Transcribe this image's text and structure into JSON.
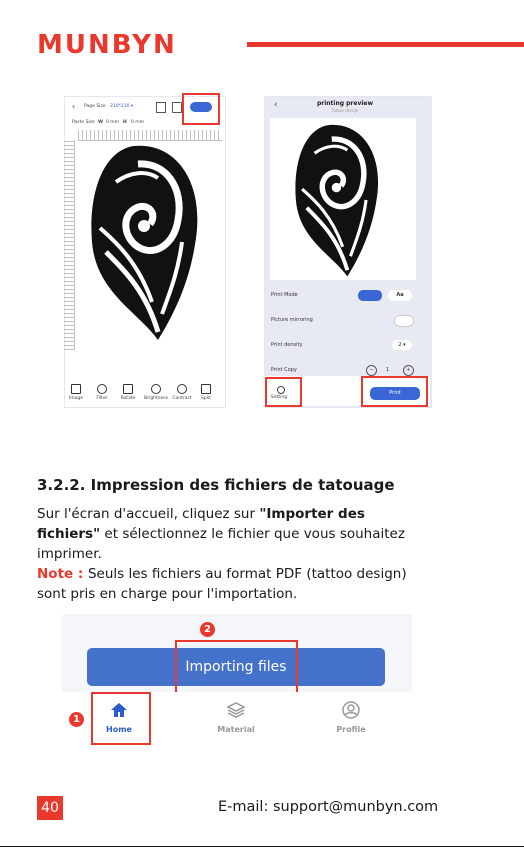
{
  "brand": {
    "logo": "MUNBYN",
    "accent": "#e8392c"
  },
  "screens": {
    "left": {
      "title_label": "Page Size",
      "title_value": "210*210 ▾",
      "paste_size_label": "Paste Size",
      "w_label": "W",
      "w_value": "0 mm",
      "h_label": "H",
      "h_value": "0 mm",
      "toolbar": [
        "Image",
        "Filter",
        "Rotate",
        "Brightness",
        "Contrast",
        "Split"
      ]
    },
    "right": {
      "title": "printing preview",
      "subtitle": "Tattoo design",
      "print_mode_label": "Print Mode",
      "print_mode_alt": "Aa",
      "mirroring_label": "Picture mirroring",
      "density_label": "Print density",
      "density_value": "2 ▾",
      "copy_label": "Print Copy",
      "copy_value": "1",
      "minus": "−",
      "plus": "+",
      "setting_label": "Setting",
      "print_label": "Print"
    }
  },
  "section": {
    "heading": "3.2.2.  Impression des fichiers de tatouage",
    "p1_a": "Sur l'écran d'accueil, cliquez sur ",
    "p1_b": "\"Importer des fichiers\"",
    "p1_c": " et sélectionnez le fichier que vous souhaitez imprimer.",
    "note_label": "Note : ",
    "note_text": "Seuls les fichiers au format PDF (tattoo design) sont pris en charge pour l'importation."
  },
  "app": {
    "import_button": "Importing files",
    "badge1": "1",
    "badge2": "2",
    "nav": [
      "Home",
      "Material",
      "Profile"
    ]
  },
  "footer": {
    "page_number": "40",
    "email": "E-mail: support@munbyn.com"
  }
}
